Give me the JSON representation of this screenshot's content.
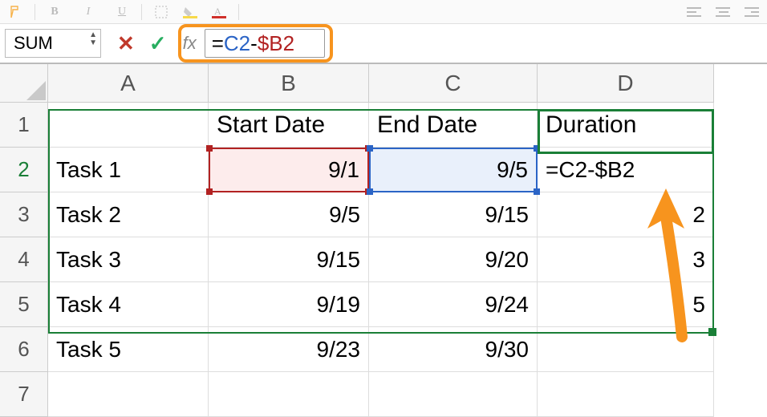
{
  "ribbon": {},
  "formula_bar": {
    "name_box": "SUM",
    "fx_label": "fx",
    "formula_eq": "=",
    "formula_c2": "C2",
    "formula_minus": "-",
    "formula_b2": "$B2"
  },
  "columns": {
    "A": "A",
    "B": "B",
    "C": "C",
    "D": "D"
  },
  "rows": {
    "1": "1",
    "2": "2",
    "3": "3",
    "4": "4",
    "5": "5",
    "6": "6",
    "7": "7"
  },
  "headers": {
    "B1": "Start Date",
    "C1": "End Date",
    "D1": "Duration"
  },
  "cells": {
    "A2": "Task 1",
    "B2": "9/1",
    "C2": "9/5",
    "D2": "=C2-$B2",
    "A3": "Task 2",
    "B3": "9/5",
    "C3": "9/15",
    "D3": "2",
    "A4": "Task 3",
    "B4": "9/15",
    "C4": "9/20",
    "D4": "3",
    "A5": "Task 4",
    "B5": "9/19",
    "C5": "9/24",
    "D5": "5",
    "A6": "Task 5",
    "B6": "9/23",
    "C6": "9/30",
    "D6": ""
  }
}
